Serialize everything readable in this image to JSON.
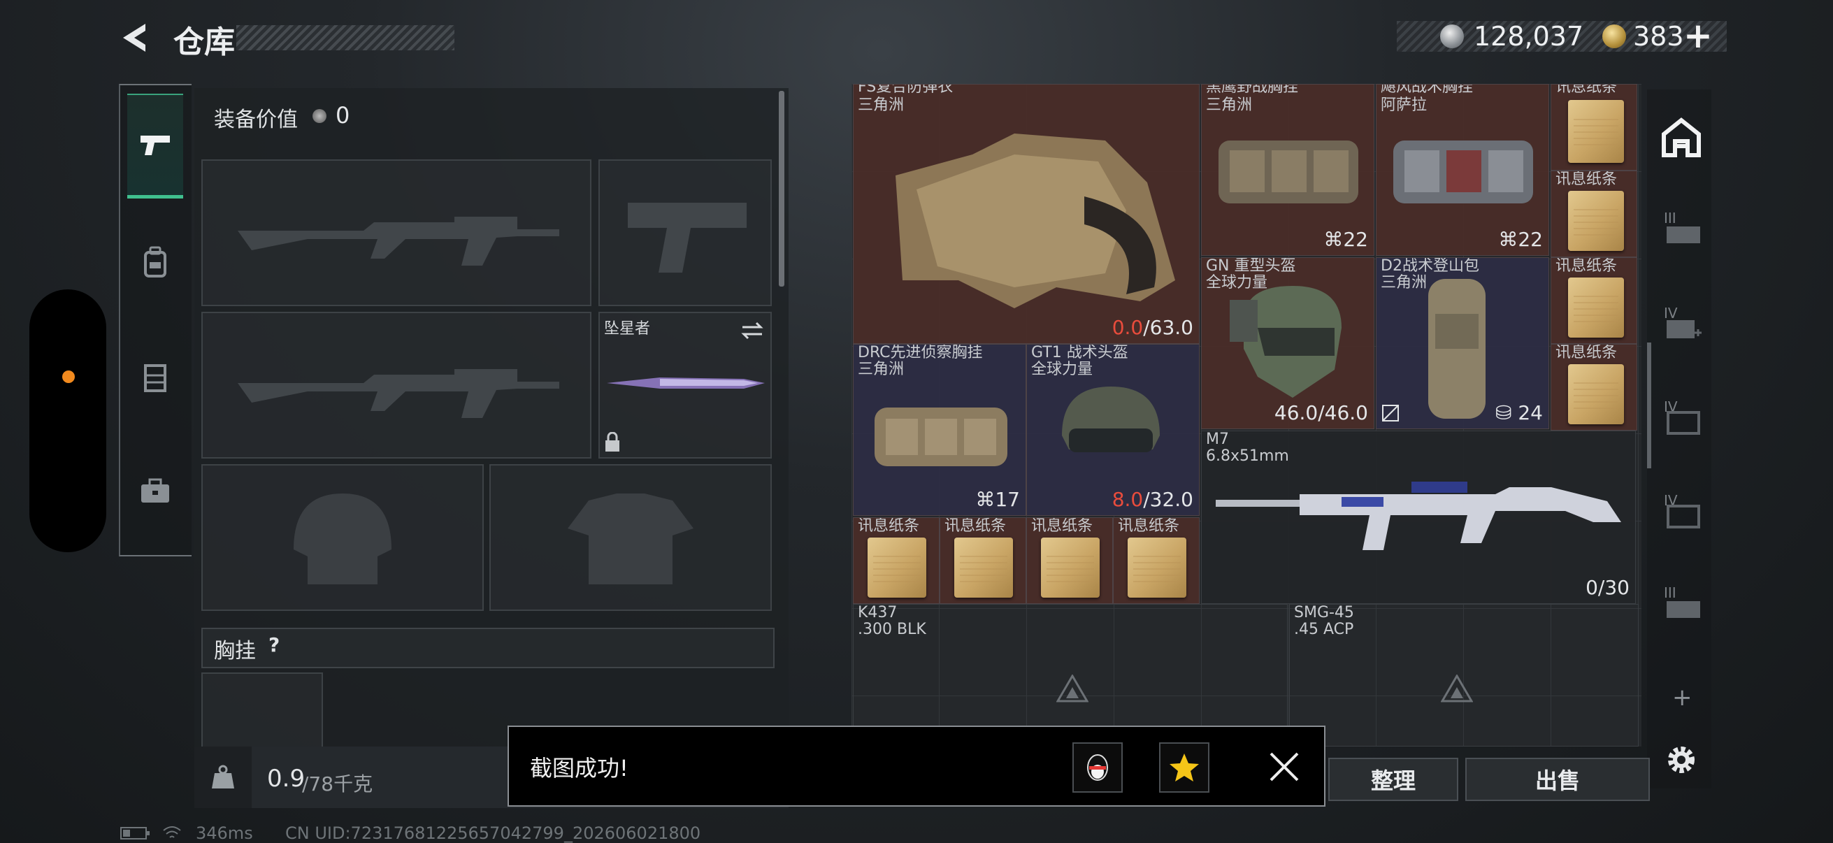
{
  "header": {
    "title": "仓库",
    "currency": {
      "silver": "128,037",
      "gold": "383",
      "add_label": "+"
    }
  },
  "sidebar_tabs": [
    {
      "icon": "pistol-icon",
      "active": true
    },
    {
      "icon": "backpack-icon",
      "active": false
    },
    {
      "icon": "rig-icon",
      "active": false
    },
    {
      "icon": "case-icon",
      "active": false
    }
  ],
  "equipment": {
    "value_label": "装备价值",
    "value": "0",
    "melee_name": "坠星者",
    "chest_label": "胸挂",
    "chest_help": "?",
    "weight_value": "0.9",
    "weight_total": "/78千克"
  },
  "inventory": {
    "items": [
      {
        "name": "FS复合防弹衣",
        "sub": "三角洲",
        "cur": "0.0",
        "max": "/63.0"
      },
      {
        "name": "黑鹰野战胸挂",
        "sub": "三角洲",
        "slots": "22"
      },
      {
        "name": "飓风战术胸挂",
        "sub": "阿萨拉",
        "slots": "22"
      },
      {
        "name": "GN 重型头盔",
        "sub": "全球力量",
        "value": "46.0/46.0"
      },
      {
        "name": "D2战术登山包",
        "sub": "三角洲",
        "slots": "24"
      },
      {
        "name": "DRC先进侦察胸挂",
        "sub": "三角洲",
        "slots": "17"
      },
      {
        "name": "GT1 战术头盔",
        "sub": "全球力量",
        "cur": "8.0",
        "max": "/32.0"
      },
      {
        "name": "M7",
        "sub": "6.8x51mm",
        "value": "0/30"
      },
      {
        "name": "K437",
        "sub": ".300 BLK"
      },
      {
        "name": "SMG-45",
        "sub": ".45 ACP"
      }
    ],
    "paper_label": "讯息纸条"
  },
  "toast": {
    "message": "截图成功!"
  },
  "actions": {
    "sort_label": "整理",
    "sell_label": "出售"
  },
  "rail_labels": [
    "III",
    "IV",
    "IV",
    "IV",
    "III"
  ],
  "rail_plus": "+",
  "status": {
    "ping": "346ms",
    "uid": "CN UID:72317681225657042799_202606021800"
  },
  "colors": {
    "accent_green": "#40c08e",
    "damage_red": "#e94c3c",
    "rare_red_bg": "#4a2c28",
    "rare_blue_bg": "#2c2d44",
    "status_dot": "#f28a1e"
  }
}
